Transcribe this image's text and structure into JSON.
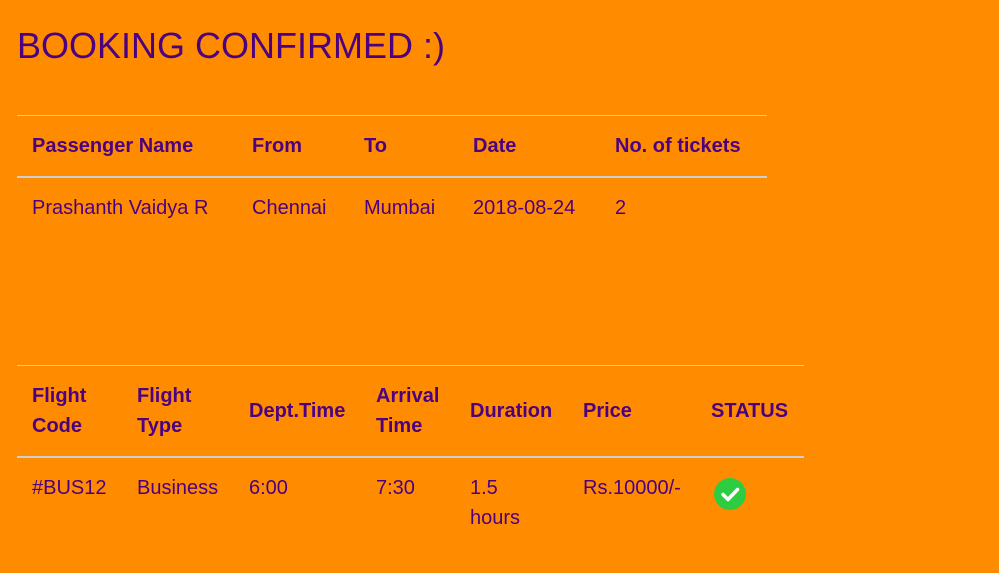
{
  "page": {
    "title": "BOOKING CONFIRMED :)"
  },
  "passenger_table": {
    "headers": [
      "Passenger Name",
      "From",
      "To",
      "Date",
      "No. of tickets"
    ],
    "row": {
      "passenger_name": "Prashanth Vaidya R",
      "from": "Chennai",
      "to": "Mumbai",
      "date": "2018-08-24",
      "tickets": "2"
    }
  },
  "flight_table": {
    "headers": {
      "flight_code": "Flight Code",
      "flight_type": "Flight Type",
      "dept_time": "Dept.Time",
      "arrival_time": "Arrival Time",
      "duration": "Duration",
      "price": "Price",
      "status": "STATUS"
    },
    "row": {
      "flight_code": "#BUS12",
      "flight_type": "Business",
      "dept_time": "6:00",
      "arrival_time": "7:30",
      "duration": "1.5 hours",
      "price": "Rs.10000/-",
      "status_icon": "check-circle-icon"
    }
  },
  "colors": {
    "background": "#ff8c00",
    "text": "#4b0082",
    "status_ok": "#2ecc40"
  }
}
